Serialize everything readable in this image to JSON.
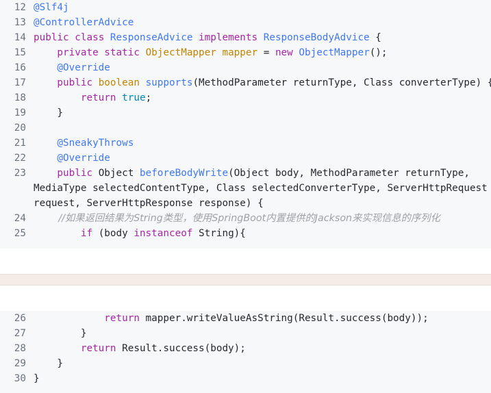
{
  "colors": {
    "background": "#f6f8fa",
    "line_number": "#6a737d",
    "keyword": "#a626a4",
    "type": "#c18401",
    "function": "#4078f2",
    "annotation": "#4078f2",
    "boolean": "#0184bc",
    "comment": "#a0a1a7",
    "text": "#24292e"
  },
  "block1": {
    "lines": [
      {
        "n": "12",
        "tokens": [
          {
            "t": "@Slf4j",
            "c": "an"
          }
        ]
      },
      {
        "n": "13",
        "tokens": [
          {
            "t": "@ControllerAdvice",
            "c": "an"
          }
        ]
      },
      {
        "n": "14",
        "tokens": [
          {
            "t": "public ",
            "c": "kw"
          },
          {
            "t": "class ",
            "c": "kw"
          },
          {
            "t": "ResponseAdvice ",
            "c": "fn"
          },
          {
            "t": "implements ",
            "c": "kw"
          },
          {
            "t": "ResponseBodyAdvice",
            "c": "fn"
          },
          {
            "t": " {",
            "c": "pl"
          }
        ]
      },
      {
        "n": "15",
        "tokens": [
          {
            "t": "    private ",
            "c": "kw"
          },
          {
            "t": "static ",
            "c": "kw"
          },
          {
            "t": "ObjectMapper ",
            "c": "ty"
          },
          {
            "t": "mapper ",
            "c": "ty"
          },
          {
            "t": "= ",
            "c": "pl"
          },
          {
            "t": "new ",
            "c": "kw"
          },
          {
            "t": "ObjectMapper",
            "c": "fn"
          },
          {
            "t": "();",
            "c": "pl"
          }
        ]
      },
      {
        "n": "16",
        "tokens": [
          {
            "t": "    @Override",
            "c": "an"
          }
        ]
      },
      {
        "n": "17",
        "tokens": [
          {
            "t": "    public ",
            "c": "kw"
          },
          {
            "t": "boolean ",
            "c": "ty"
          },
          {
            "t": "supports",
            "c": "fn"
          },
          {
            "t": "(MethodParameter returnType, Class converterType) {",
            "c": "pl"
          }
        ]
      },
      {
        "n": "18",
        "tokens": [
          {
            "t": "        return ",
            "c": "kw"
          },
          {
            "t": "true",
            "c": "bool"
          },
          {
            "t": ";",
            "c": "pl"
          }
        ]
      },
      {
        "n": "19",
        "tokens": [
          {
            "t": "    }",
            "c": "pl"
          }
        ]
      },
      {
        "n": "20",
        "tokens": [
          {
            "t": "",
            "c": "pl"
          }
        ]
      },
      {
        "n": "21",
        "tokens": [
          {
            "t": "    @SneakyThrows",
            "c": "an"
          }
        ]
      },
      {
        "n": "22",
        "tokens": [
          {
            "t": "    @Override",
            "c": "an"
          }
        ]
      },
      {
        "n": "23",
        "tokens": [
          {
            "t": "    public ",
            "c": "kw"
          },
          {
            "t": "Object ",
            "c": "pl"
          },
          {
            "t": "beforeBodyWrite",
            "c": "fn"
          },
          {
            "t": "(Object body, MethodParameter returnType,",
            "c": "pl"
          }
        ],
        "continuation": [
          "MediaType selectedContentType, Class selectedConverterType, ServerHttpRequest",
          "request, ServerHttpResponse response) {"
        ]
      },
      {
        "n": "24",
        "tokens": [
          {
            "t": "        //如果返回结果为String类型，使用SpringBoot内置提供的Jackson来实现信息的序列化",
            "c": "cm"
          }
        ]
      },
      {
        "n": "25",
        "tokens": [
          {
            "t": "        if ",
            "c": "kw"
          },
          {
            "t": "(body ",
            "c": "pl"
          },
          {
            "t": "instanceof ",
            "c": "kw"
          },
          {
            "t": "String){",
            "c": "pl"
          }
        ]
      }
    ]
  },
  "block2": {
    "lines": [
      {
        "n": "26",
        "tokens": [
          {
            "t": "            return ",
            "c": "kw"
          },
          {
            "t": "mapper.writeValueAsString(Result.success(body));",
            "c": "pl"
          }
        ]
      },
      {
        "n": "27",
        "tokens": [
          {
            "t": "        }",
            "c": "pl"
          }
        ]
      },
      {
        "n": "28",
        "tokens": [
          {
            "t": "        return ",
            "c": "kw"
          },
          {
            "t": "Result.success(body);",
            "c": "pl"
          }
        ]
      },
      {
        "n": "29",
        "tokens": [
          {
            "t": "    }",
            "c": "pl"
          }
        ]
      },
      {
        "n": "30",
        "tokens": [
          {
            "t": "}",
            "c": "pl"
          }
        ]
      }
    ]
  }
}
